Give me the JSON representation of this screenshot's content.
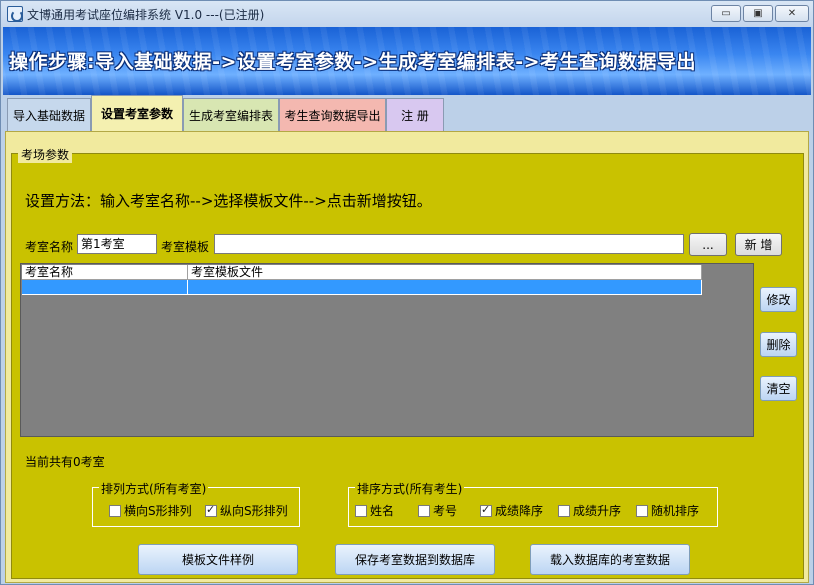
{
  "window": {
    "title": "文博通用考试座位编排系统 V1.0 ---(已注册)",
    "minimize_glyph": "▭",
    "maximize_glyph": "▣",
    "close_glyph": "✕"
  },
  "banner": {
    "text": "操作步骤:导入基础数据->设置考室参数->生成考室编排表->考生查询数据导出"
  },
  "tabs": [
    {
      "label": "导入基础数据"
    },
    {
      "label": "设置考室参数"
    },
    {
      "label": "生成考室编排表"
    },
    {
      "label": "考生查询数据导出"
    },
    {
      "label": "注 册"
    }
  ],
  "group": {
    "title": "考场参数",
    "instruction": "设置方法：输入考室名称-->选择模板文件-->点击新增按钮。",
    "room_name_label": "考室名称",
    "room_name_value": "第1考室",
    "template_label": "考室模板",
    "template_value": "",
    "browse_label": "...",
    "add_label": "新 增",
    "grid": {
      "columns": [
        "考室名称",
        "考室模板文件"
      ],
      "rows": [
        [
          "",
          ""
        ]
      ]
    },
    "edit_label": "修改",
    "delete_label": "删除",
    "clear_label": "清空",
    "count_text": "当前共有0考室"
  },
  "arrange": {
    "title": "排列方式(所有考室)",
    "options": [
      {
        "label": "横向S形排列",
        "checked": false
      },
      {
        "label": "纵向S形排列",
        "checked": true
      }
    ]
  },
  "sort": {
    "title": "排序方式(所有考生)",
    "options": [
      {
        "label": "姓名",
        "checked": false
      },
      {
        "label": "考号",
        "checked": false
      },
      {
        "label": "成绩降序",
        "checked": true
      },
      {
        "label": "成绩升序",
        "checked": false
      },
      {
        "label": "随机排序",
        "checked": false
      }
    ]
  },
  "footer_buttons": {
    "sample": "模板文件样例",
    "save": "保存考室数据到数据库",
    "load": "载入数据库的考室数据"
  },
  "colors": {
    "panel": "#c9c200",
    "selection": "#3399ff",
    "banner": "#3a86f0"
  }
}
